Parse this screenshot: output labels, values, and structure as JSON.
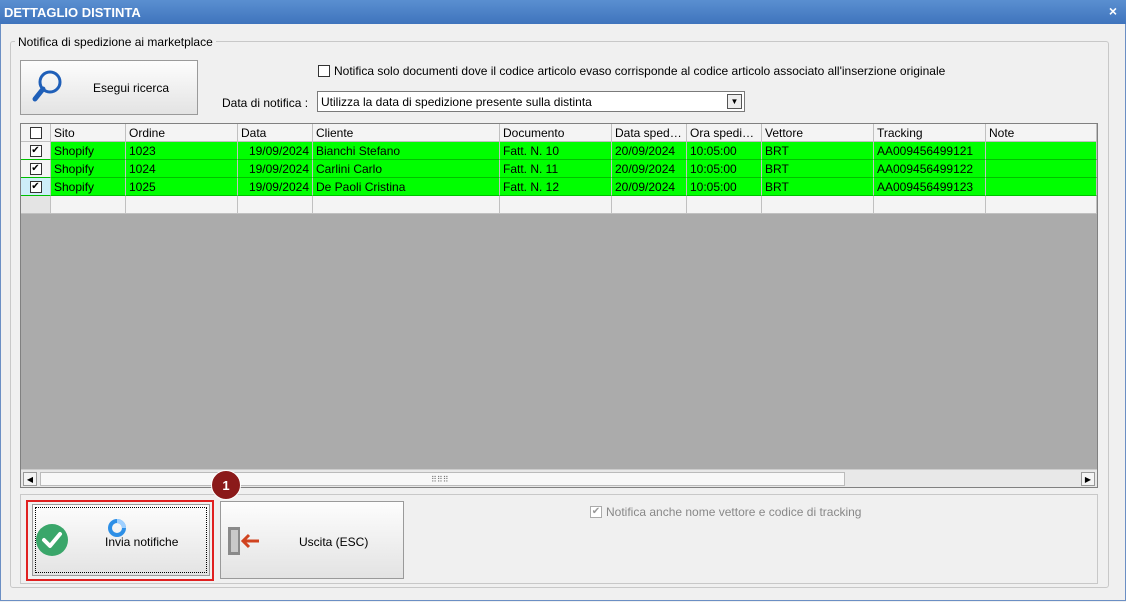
{
  "window": {
    "title": "DETTAGLIO DISTINTA",
    "close_glyph": "×"
  },
  "group": {
    "title": "Notifica di spedizione ai marketplace"
  },
  "search": {
    "label": "Esegui ricerca",
    "icon": "magnifier-icon"
  },
  "filter": {
    "only_matching_label": "Notifica solo documenti dove il codice articolo evaso corrisponde al codice articolo associato all'inserzione originale",
    "only_matching_checked": false
  },
  "date": {
    "label": "Data di notifica :",
    "selected": "Utilizza la data di spedizione presente sulla distinta"
  },
  "table": {
    "columns": [
      "Sito",
      "Ordine",
      "Data",
      "Cliente",
      "Documento",
      "Data sped…",
      "Ora spedi…",
      "Vettore",
      "Tracking",
      "Note"
    ],
    "rows": [
      {
        "checked": true,
        "cells": [
          "Shopify",
          "1023",
          "19/09/2024",
          "Bianchi Stefano",
          "Fatt. N. 10",
          "20/09/2024",
          "10:05:00",
          "BRT",
          "AA009456499121",
          ""
        ]
      },
      {
        "checked": true,
        "cells": [
          "Shopify",
          "1024",
          "19/09/2024",
          "Carlini Carlo",
          "Fatt. N. 11",
          "20/09/2024",
          "10:05:00",
          "BRT",
          "AA009456499122",
          ""
        ]
      },
      {
        "checked": true,
        "cells": [
          "Shopify",
          "1025",
          "19/09/2024",
          "De Paoli Cristina",
          "Fatt. N. 12",
          "20/09/2024",
          "10:05:00",
          "BRT",
          "AA009456499123",
          ""
        ]
      }
    ],
    "row_color": "#00ff00"
  },
  "actions": {
    "send_label": "Invia notifiche",
    "exit_label": "Uscita (ESC)",
    "step_badge": "1"
  },
  "tracking": {
    "label": "Notifica anche nome vettore e codice di tracking",
    "checked": true
  }
}
